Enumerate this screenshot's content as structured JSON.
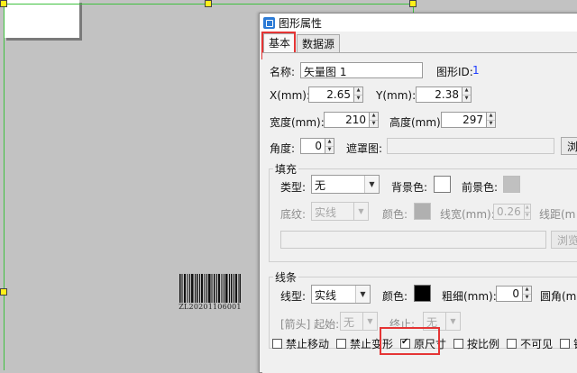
{
  "barcode": {
    "text": "ZL20201106001"
  },
  "dialog": {
    "title": "图形属性",
    "tabs": [
      "基本",
      "数据源"
    ],
    "name_label": "名称:",
    "name_value": "矢量图 1",
    "id_label": "图形ID:",
    "id_value": "1",
    "x_label": "X(mm):",
    "x_value": "2.65",
    "y_label": "Y(mm):",
    "y_value": "2.38",
    "width_label": "宽度(mm):",
    "width_value": "210",
    "height_label": "高度(mm):",
    "height_value": "297",
    "angle_label": "角度:",
    "angle_value": "0",
    "mask_label": "遮罩图:",
    "browse_label": "浏",
    "fill": {
      "title": "填充",
      "type_label": "类型:",
      "type_value": "无",
      "bg_label": "背景色:",
      "fg_label": "前景色:",
      "pattern_label": "底纹:",
      "pattern_value": "实线",
      "color_label": "颜色:",
      "line_width_label": "线宽(mm):",
      "line_width_value": "0.26",
      "spacing_label": "线距(m",
      "browse_label": "浏览",
      "bg_color": "#ffffff",
      "fg_color": "#c0c0c0",
      "pattern_color": "#b0b0b0"
    },
    "stroke": {
      "title": "线条",
      "type_label": "线型:",
      "type_value": "实线",
      "color_label": "颜色:",
      "color": "#000000",
      "thickness_label": "粗细(mm):",
      "thickness_value": "0",
      "radius_label": "圆角(m",
      "arrow_label": "[箭头] 起始:",
      "arrow_start_value": "无",
      "arrow_end_label": "终止:",
      "arrow_end_value": "无"
    },
    "checkboxes": [
      {
        "label": "禁止移动",
        "checked": false
      },
      {
        "label": "禁止变形",
        "checked": false
      },
      {
        "label": "原尺寸",
        "checked": true
      },
      {
        "label": "按比例",
        "checked": false
      },
      {
        "label": "不可见",
        "checked": false
      },
      {
        "label": "镜像",
        "checked": false
      }
    ],
    "highlight_color": "#e53535"
  }
}
